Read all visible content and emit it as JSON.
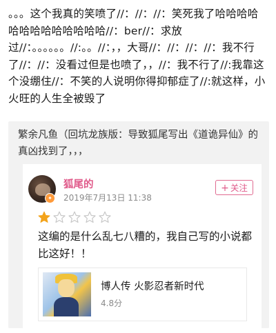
{
  "comment": {
    "text": "。。。这个我真的笑喷了//：//：//：笑死我了哈哈哈哈哈哈哈哈哈哈哈哈哈//：ber//：求放过//：。。。。。。//:。。//：，，大哥//：//：//：//：我不行了//：//：没看过但是也喷了，，//：我不行了//:我靠这个没绷住//：不笑的人说明你得抑郁症了//:就这样，小火旺的人生全被毁了"
  },
  "quote": {
    "header": "繁余凡鱼（回坑龙族版：导致狐尾写出《道诡异仙》的真凶找到了，，，",
    "card": {
      "username": "狐尾的",
      "time": "2019年7月13日 11:38",
      "follow_label": "关注",
      "follow_icon": "plus-icon",
      "rating": {
        "value": 1,
        "max": 5,
        "filled_color": "#f3a31b",
        "empty_color": "#c8c8c8"
      },
      "review_text": "这编的是什么乱七八糟的，我自己写的小说都比这好！！",
      "book": {
        "title": "博人传 火影忍者新时代",
        "score": "4.8分"
      }
    }
  },
  "colors": {
    "accent_pink": "#e05a8a",
    "quote_bg": "#f2f2f2"
  }
}
